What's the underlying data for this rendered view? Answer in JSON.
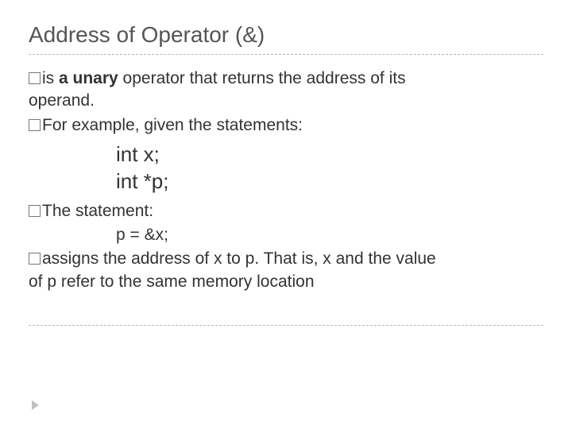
{
  "title": "Address of Operator (&)",
  "bullets": {
    "b1_lead": "is",
    "b1_bold": " a unary ",
    "b1_rest1": "operator that returns the address of its",
    "b1_line2": "operand.",
    "b2": "For example, given the statements:",
    "code1": "int x;",
    "code2": "int *p;",
    "b3": "The statement:",
    "code3": "p = &x;",
    "b4_line1": "assigns the address of x to p. That is, x and the value",
    "b4_line2": "of p refer to the same memory location"
  }
}
